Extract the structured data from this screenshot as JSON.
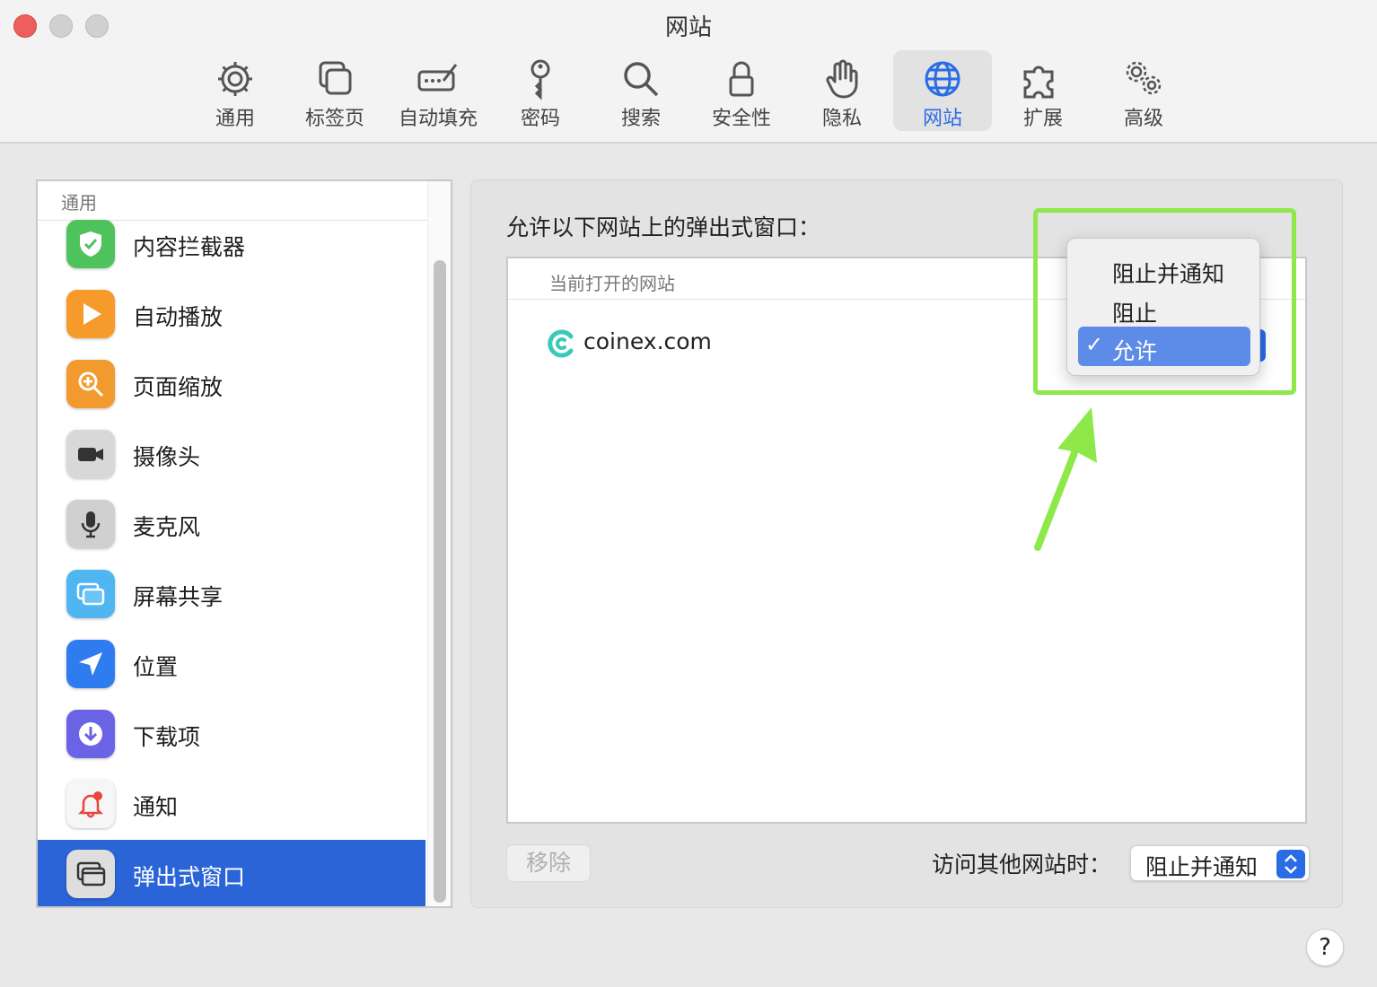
{
  "window": {
    "title": "网站"
  },
  "toolbar": {
    "items": [
      {
        "label": "通用",
        "icon": "gear-icon"
      },
      {
        "label": "标签页",
        "icon": "tabs-icon"
      },
      {
        "label": "自动填充",
        "icon": "autofill-icon"
      },
      {
        "label": "密码",
        "icon": "key-icon"
      },
      {
        "label": "搜索",
        "icon": "search-icon"
      },
      {
        "label": "安全性",
        "icon": "lock-icon"
      },
      {
        "label": "隐私",
        "icon": "hand-icon"
      },
      {
        "label": "网站",
        "icon": "globe-icon",
        "active": true
      },
      {
        "label": "扩展",
        "icon": "puzzle-icon"
      },
      {
        "label": "高级",
        "icon": "gears-icon"
      }
    ]
  },
  "sidebar": {
    "header": "通用",
    "items": [
      {
        "label": "内容拦截器",
        "icon": "shield-check-icon",
        "color": "#4fc35b"
      },
      {
        "label": "自动播放",
        "icon": "play-icon",
        "color": "#f59a2b"
      },
      {
        "label": "页面缩放",
        "icon": "zoom-icon",
        "color": "#f39a2e"
      },
      {
        "label": "摄像头",
        "icon": "camera-icon",
        "color": "#9a9a9a"
      },
      {
        "label": "麦克风",
        "icon": "microphone-icon",
        "color": "#b5b5b5"
      },
      {
        "label": "屏幕共享",
        "icon": "screen-share-icon",
        "color": "#4fb6f2"
      },
      {
        "label": "位置",
        "icon": "location-icon",
        "color": "#2f7cf0"
      },
      {
        "label": "下载项",
        "icon": "download-icon",
        "color": "#6b63e6"
      },
      {
        "label": "通知",
        "icon": "bell-icon",
        "color": "#f6f6f6"
      },
      {
        "label": "弹出式窗口",
        "icon": "popup-window-icon",
        "color": "#dedede",
        "selected": true
      }
    ]
  },
  "main": {
    "title": "允许以下网站上的弹出式窗口：",
    "table": {
      "column_header": "当前打开的网站",
      "rows": [
        {
          "site": "coinex.com",
          "icon": "coinex-logo-icon"
        }
      ]
    },
    "remove_button": "移除",
    "other_sites_label": "访问其他网站时：",
    "other_sites_value": "阻止并通知"
  },
  "dropdown": {
    "options": [
      {
        "label": "阻止并通知",
        "checked": false
      },
      {
        "label": "阻止",
        "checked": false
      },
      {
        "label": "允许",
        "checked": true
      }
    ],
    "check_mark": "✓"
  },
  "help_button": "?",
  "colors": {
    "accent": "#2a6be6",
    "selection": "#2a64d6",
    "highlight_annotation": "#8fe84a"
  }
}
